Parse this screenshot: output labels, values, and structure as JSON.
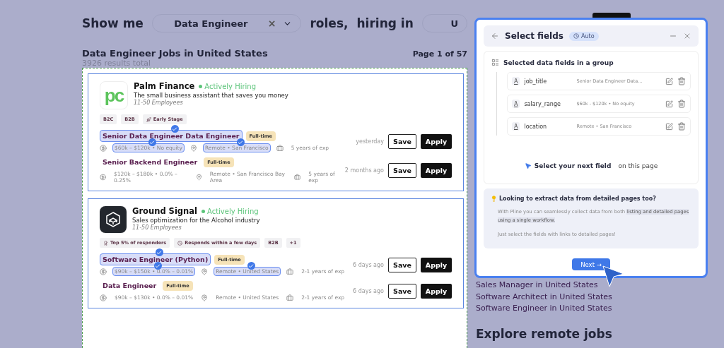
{
  "search_bar": {
    "prefix": "Show me",
    "role_field": {
      "value": "Data Engineer",
      "clear": "×"
    },
    "middle": "roles,",
    "location_label": "hiring in",
    "location_field": {
      "value": "U"
    }
  },
  "results": {
    "title": "Data Engineer Jobs in United States",
    "page": "Page 1 of 57",
    "total": "3926 results total"
  },
  "companies": [
    {
      "name": "Palm Finance",
      "logo": {
        "kind": "letters",
        "text": "pc"
      },
      "status": "Actively Hiring",
      "tagline": "The small business assistant that saves you money",
      "size": "11-50 Employees",
      "highlighted": true,
      "tags": [
        {
          "label": "B2C",
          "kind": "plain"
        },
        {
          "label": "B2B",
          "kind": "plain"
        },
        {
          "label": "Early Stage",
          "kind": "stage"
        }
      ],
      "jobs": [
        {
          "title": "Senior Data Engineer Data Engineer",
          "type": "Full-time",
          "salary": "$60k – $120k • No equity",
          "location": "Remote • San Francisco",
          "experience": "5 years of exp",
          "posted": "yesterday",
          "save": "Save",
          "apply": "Apply",
          "title_selected": true,
          "salary_selected": true,
          "location_selected": true
        },
        {
          "title": "Senior Backend Engineer",
          "type": "Full-time",
          "salary": "$120k – $180k • 0.0% – 0.25%",
          "location": "Remote • San Francisco Bay Area",
          "experience": "5 years of exp",
          "posted": "2 months ago",
          "save": "Save",
          "apply": "Apply",
          "title_selected": false,
          "salary_selected": false,
          "location_selected": false
        }
      ]
    },
    {
      "name": "Ground Signal",
      "logo": {
        "kind": "cube"
      },
      "status": "Actively Hiring",
      "tagline": "Sales optimization for the Alcohol industry",
      "size": "11-50 Employees",
      "highlighted": true,
      "tags": [
        {
          "label": "Top 5% of responders",
          "kind": "award"
        },
        {
          "label": "Responds within a few days",
          "kind": "clock"
        },
        {
          "label": "B2B",
          "kind": "plain"
        },
        {
          "label": "+1",
          "kind": "more"
        }
      ],
      "jobs": [
        {
          "title": "Software Engineer (Python)",
          "type": "Full-time",
          "salary": "$90k – $150k • 0.0% – 0.01%",
          "location": "Remote • United States",
          "experience": "2-1 years of exp",
          "posted": "6 days ago",
          "save": "Save",
          "apply": "Apply",
          "title_selected": true,
          "salary_selected": true,
          "location_selected": true
        },
        {
          "title": "Data Engineer",
          "type": "Full-time",
          "salary": "$90k – $130k • 0.0% – 0.01%",
          "location": "Remote • United States",
          "experience": "2-1 years of exp",
          "posted": "6 days ago",
          "save": "Save",
          "apply": "Apply",
          "title_selected": false,
          "salary_selected": false,
          "location_selected": false
        }
      ]
    }
  ],
  "side_links": [
    "Sales Manager in United States",
    "Software Architect in United States",
    "Software Engineer in United States"
  ],
  "side_heading": "Explore remote jobs",
  "panel": {
    "title": "Select fields",
    "mode": "Auto",
    "group_title": "Selected data fields in a group",
    "fields": [
      {
        "type_icon": "A",
        "name": "job_title",
        "sample": "Senior Data Engineer Data..."
      },
      {
        "type_icon": "A",
        "name": "salary_range",
        "sample": "$60k - $120k • No equity"
      },
      {
        "type_icon": "A",
        "name": "location",
        "sample": "Remote • San Francisco"
      }
    ],
    "hint_strong": "Select your next field",
    "hint_rest": "on this page",
    "info": {
      "title": "Looking to extract data from detailed pages too?",
      "text_before": "With Pline you can seamlessly collect data from both",
      "text_mark": "listing and detailed pages using a single workflow.",
      "text_after": "Just select the fields with links to detailed pages!"
    },
    "next": "Next →"
  }
}
